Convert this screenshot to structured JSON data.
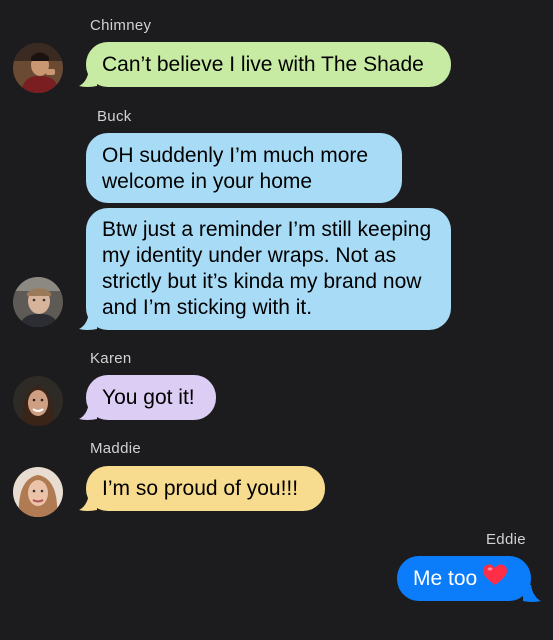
{
  "colors": {
    "background": "#1c1c1e",
    "green": "#c8eba3",
    "blue": "#a8dcf6",
    "purple": "#dccdf5",
    "yellow": "#f7db8e",
    "outgoing": "#0b7dfa",
    "heart": "#ff2d45"
  },
  "messages": [
    {
      "sender": "Chimney",
      "text": "Can’t believe I live with The Shade"
    },
    {
      "sender": "Buck",
      "text1": "OH suddenly I’m much more welcome in your home",
      "text2": "Btw just a reminder I’m still keeping my identity under wraps. Not as strictly but it’s kinda my brand now and I’m sticking with it."
    },
    {
      "sender": "Karen",
      "text": "You got it!"
    },
    {
      "sender": "Maddie",
      "text": "I’m so proud of you!!!"
    },
    {
      "sender": "Eddie",
      "text": "Me too",
      "emoji": "heart-icon"
    }
  ]
}
